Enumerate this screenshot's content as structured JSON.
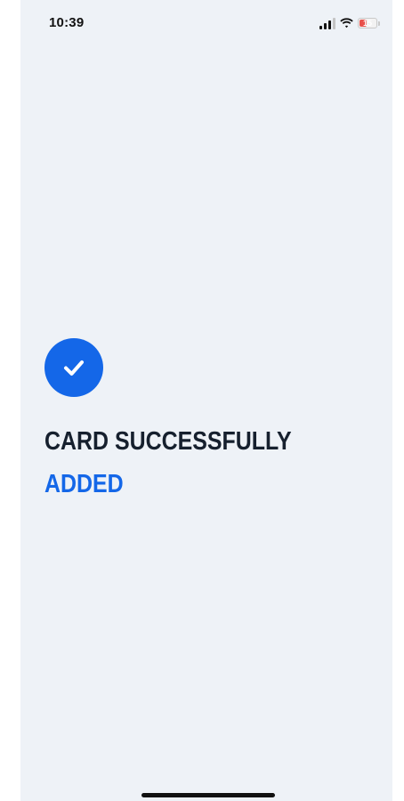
{
  "status_bar": {
    "time": "10:39",
    "battery_level": "15",
    "battery_fraction": 0.15,
    "battery_color": "#e8504a",
    "icons": [
      "signal-icon",
      "wifi-icon",
      "battery-icon"
    ]
  },
  "confirmation": {
    "icon": "checkmark-icon",
    "title_line1": "CARD SUCCESSFULLY",
    "title_line2": "ADDED"
  },
  "colors": {
    "background": "#eef2f7",
    "accent": "#1467e8",
    "text_dark": "#16202e"
  }
}
